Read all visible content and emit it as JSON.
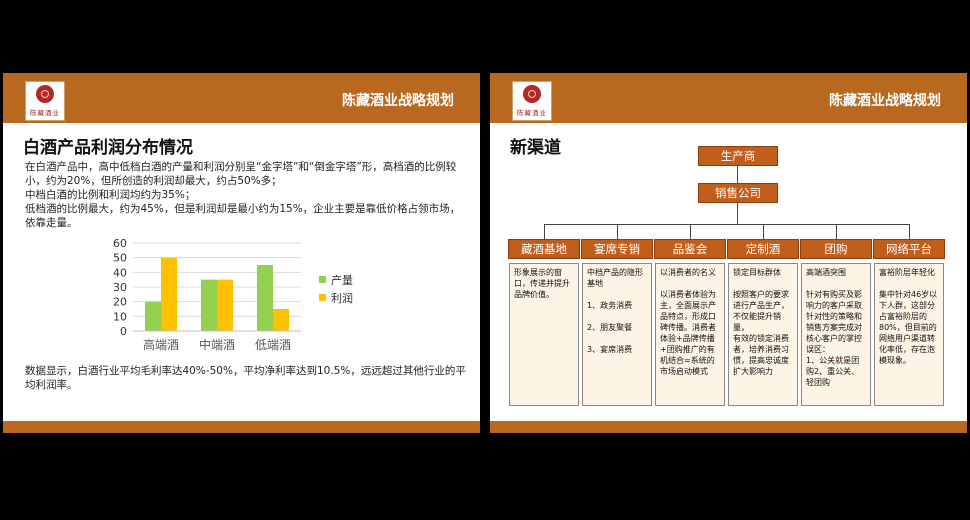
{
  "brand": {
    "logo_text": "陈藏酒业",
    "header_title": "陈藏酒业战略规划"
  },
  "slide1": {
    "title": "白酒产品利润分布情况",
    "paragraph": "在白酒产品中，高中低档白酒的产量和利润分别呈“金字塔”和“倒金字塔”形，高档酒的比例较小，约为20%，但所创造的利润却最大，约占50%多；\n中档白酒的比例和利润均约为35%；\n低档酒的比例最大，约为45%，但是利润却是最小约为15%，企业主要是靠低价格占领市场，依靠走量。",
    "footer_paragraph": "数据显示，白酒行业平均毛利率达40%-50%，平均净利率达到10.5%，远远超过其他行业的平均利润率。"
  },
  "chart_data": {
    "type": "bar",
    "categories": [
      "高端酒",
      "中端酒",
      "低端酒"
    ],
    "series": [
      {
        "name": "产量",
        "values": [
          20,
          35,
          45
        ],
        "color": "#92d050"
      },
      {
        "name": "利润",
        "values": [
          50,
          35,
          15
        ],
        "color": "#ffc000"
      }
    ],
    "ylim": [
      0,
      60
    ],
    "yticks": [
      "0",
      "10",
      "20",
      "30",
      "40",
      "50",
      "60"
    ],
    "grid": true,
    "legend": "right"
  },
  "slide2": {
    "title": "新渠道",
    "producer": "生产商",
    "sales": "销售公司",
    "channels": [
      {
        "label": "藏酒基地",
        "text": "形象展示的窗口，传递并提升品牌价值。"
      },
      {
        "label": "宴席专销",
        "text": "中档产品的隐形基地\n\n1、政务消费\n\n2、朋友聚餐\n\n3、宴席消费"
      },
      {
        "label": "品鉴会",
        "text": "以消费者的名义\n\n以消费者体验为主，全面展示产品特点，形成口碑传播。消费者体验+品牌传播+团购推广的有机结合=系统的市场启动模式"
      },
      {
        "label": "定制酒",
        "text": "锁定目标群体\n\n按照客户的要求进行产品生产，不仅能提升销量，\n有效的锁定消费者，培养消费习惯，提高忠诚度扩大影响力"
      },
      {
        "label": "团购",
        "text": "高端酒突围\n\n针对有购买及影响力的客户采取针对性的策略和销售方案完成对核心客户的掌控误区：\n1、公关就是团购2、重公关、轻团购"
      },
      {
        "label": "网络平台",
        "text": "富裕阶层年轻化\n\n集中针对46岁以下人群，这部分占富裕阶层的80%，但目前的网络用户渠道转化率低，存在泡模现象。"
      }
    ]
  }
}
